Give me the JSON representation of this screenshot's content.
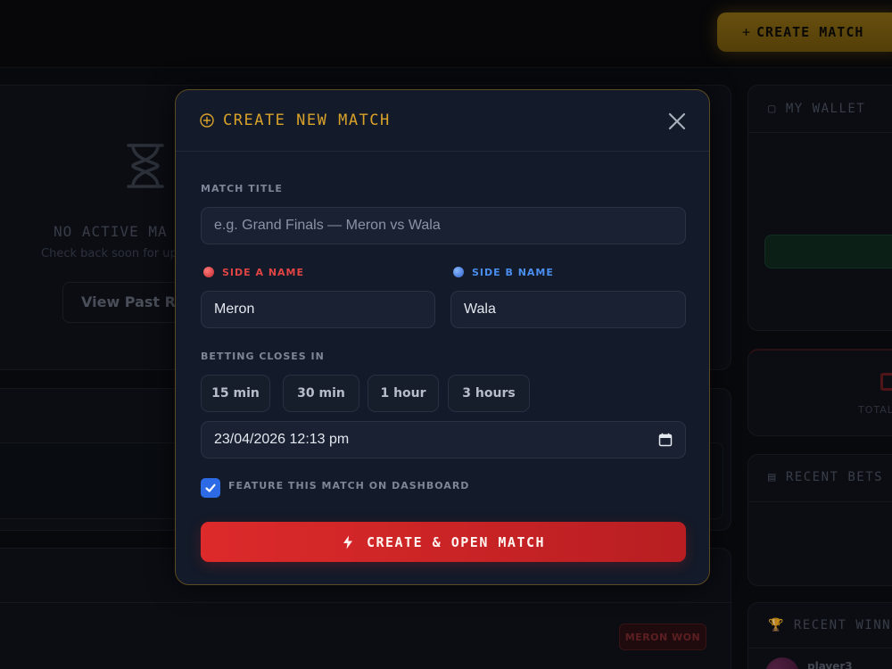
{
  "header": {
    "create_match_label": "CREATE MATCH"
  },
  "background": {
    "no_active_title": "NO ACTIVE MA",
    "no_active_sub": "Check back soon for upc",
    "view_past_label": "View Past Re",
    "meron_won_badge": "MERON WON",
    "wallet_title": "MY WALLET",
    "total_label": "TOTAL",
    "recent_bets_title": "RECENT BETS",
    "recent_winners_title": "RECENT WINN",
    "winner_name": "player3"
  },
  "modal": {
    "title": "CREATE NEW MATCH",
    "match_title_label": "MATCH TITLE",
    "match_title_placeholder": "e.g. Grand Finals — Meron vs Wala",
    "match_title_value": "",
    "side_a_label": "SIDE A NAME",
    "side_a_value": "Meron",
    "side_b_label": "SIDE B NAME",
    "side_b_value": "Wala",
    "betting_closes_label": "BETTING CLOSES IN",
    "quick_options": [
      "15 min",
      "30 min",
      "1 hour",
      "3 hours"
    ],
    "datetime_value": "23/04/2026 12:13 pm",
    "feature_label": "FEATURE THIS MATCH ON DASHBOARD",
    "feature_checked": true,
    "submit_label": "CREATE & OPEN MATCH"
  },
  "colors": {
    "accent_gold": "#d9a22a",
    "side_a_red": "#e04444",
    "side_b_blue": "#4a8ef0",
    "submit_red": "#dd2a2a",
    "checkbox_blue": "#2d6be6"
  },
  "icons": {
    "modal_title": "plus-circle-icon",
    "close": "close-icon",
    "calendar": "calendar-icon",
    "bolt": "bolt-icon",
    "hourglass": "hourglass-icon"
  }
}
